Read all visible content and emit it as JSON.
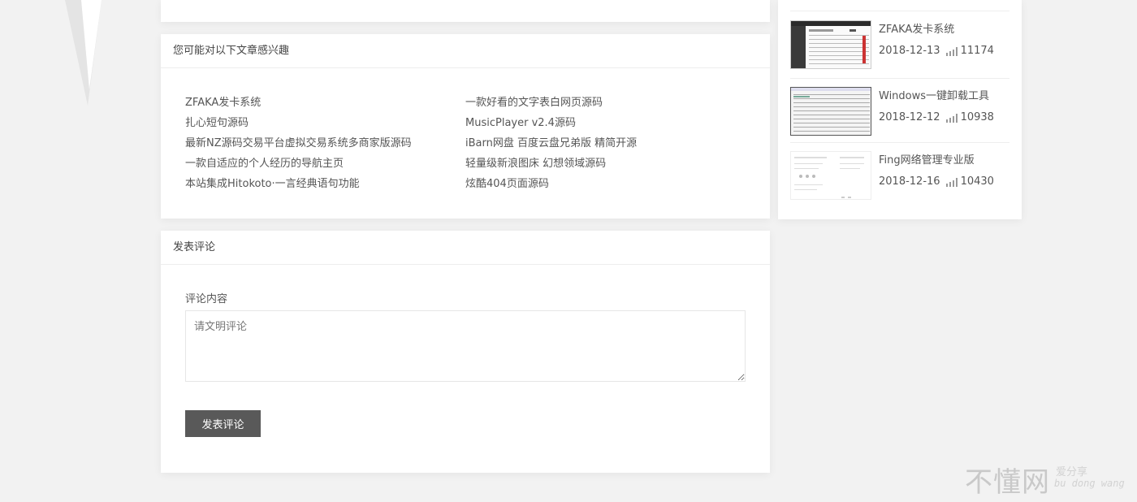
{
  "related": {
    "title": "您可能对以下文章感兴趣",
    "left": [
      "ZFAKA发卡系统",
      "扎心短句源码",
      "最新NZ源码交易平台虚拟交易系统多商家版源码",
      "一款自适应的个人经历的导航主页",
      "本站集成Hitokoto·一言经典语句功能"
    ],
    "right": [
      "一款好看的文字表白网页源码",
      "MusicPlayer v2.4源码",
      "iBarn网盘 百度云盘兄弟版 精简开源",
      "轻量级新浪图床 幻想领域源码",
      "炫酷404页面源码"
    ]
  },
  "comment": {
    "title": "发表评论",
    "label": "评论内容",
    "placeholder": "请文明评论",
    "submit_label": "发表评论"
  },
  "sidebar": {
    "items": [
      {
        "title": "ZFAKA发卡系统",
        "date": "2018-12-13",
        "views": "11174"
      },
      {
        "title": "Windows一键卸载工具",
        "date": "2018-12-12",
        "views": "10938"
      },
      {
        "title": "Fing网络管理专业版",
        "date": "2018-12-16",
        "views": "10430"
      }
    ]
  },
  "watermark": {
    "main": "不懂网",
    "sub": "爱分享",
    "pinyin": "bu dong wang"
  }
}
